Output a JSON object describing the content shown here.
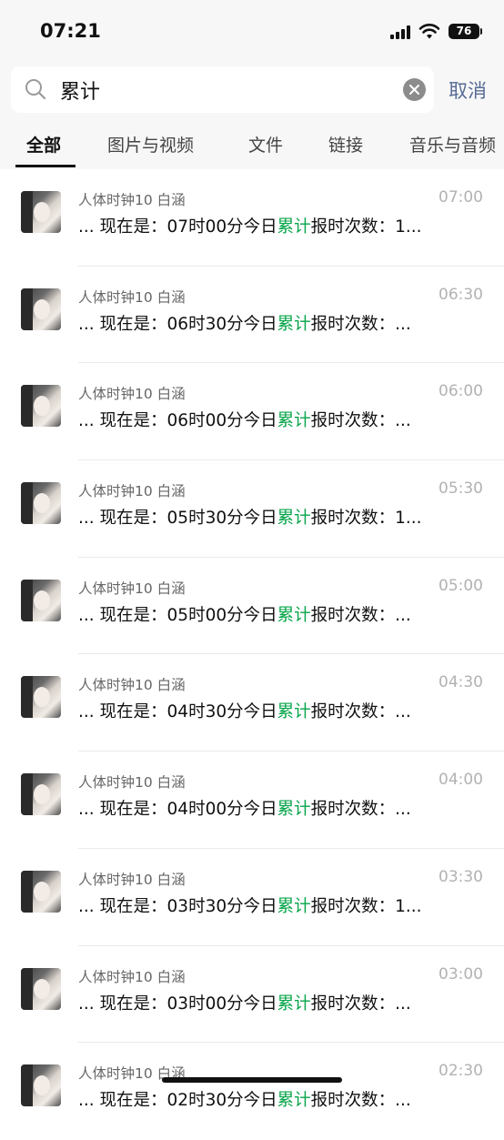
{
  "status_bar": {
    "time": "07:21",
    "battery": "76"
  },
  "search": {
    "query": "累计",
    "placeholder": "",
    "cancel_label": "取消"
  },
  "tabs": [
    {
      "label": "全部",
      "active": true
    },
    {
      "label": "图片与视频"
    },
    {
      "label": "文件"
    },
    {
      "label": "链接"
    },
    {
      "label": "音乐与音频"
    }
  ],
  "results": [
    {
      "sender": "人体时钟10 白涵",
      "time": "07:00",
      "prefix": "... 现在是：07时00分今日",
      "highlight": "累计",
      "suffix": "报时次数：1..."
    },
    {
      "sender": "人体时钟10 白涵",
      "time": "06:30",
      "prefix": "... 现在是：06时30分今日",
      "highlight": "累计",
      "suffix": "报时次数：..."
    },
    {
      "sender": "人体时钟10 白涵",
      "time": "06:00",
      "prefix": "... 现在是：06时00分今日",
      "highlight": "累计",
      "suffix": "报时次数：..."
    },
    {
      "sender": "人体时钟10 白涵",
      "time": "05:30",
      "prefix": "... 现在是：05时30分今日",
      "highlight": "累计",
      "suffix": "报时次数：1..."
    },
    {
      "sender": "人体时钟10 白涵",
      "time": "05:00",
      "prefix": "... 现在是：05时00分今日",
      "highlight": "累计",
      "suffix": "报时次数：..."
    },
    {
      "sender": "人体时钟10 白涵",
      "time": "04:30",
      "prefix": "... 现在是：04时30分今日",
      "highlight": "累计",
      "suffix": "报时次数：..."
    },
    {
      "sender": "人体时钟10 白涵",
      "time": "04:00",
      "prefix": "... 现在是：04时00分今日",
      "highlight": "累计",
      "suffix": "报时次数：..."
    },
    {
      "sender": "人体时钟10 白涵",
      "time": "03:30",
      "prefix": "... 现在是：03时30分今日",
      "highlight": "累计",
      "suffix": "报时次数：1..."
    },
    {
      "sender": "人体时钟10 白涵",
      "time": "03:00",
      "prefix": "... 现在是：03时00分今日",
      "highlight": "累计",
      "suffix": "报时次数：..."
    },
    {
      "sender": "人体时钟10 白涵",
      "time": "02:30",
      "prefix": "... 现在是：02时30分今日",
      "highlight": "累计",
      "suffix": "报时次数：..."
    }
  ],
  "colors": {
    "highlight": "#07a54a",
    "cancel": "#576b95",
    "time": "#b2b2b2"
  }
}
